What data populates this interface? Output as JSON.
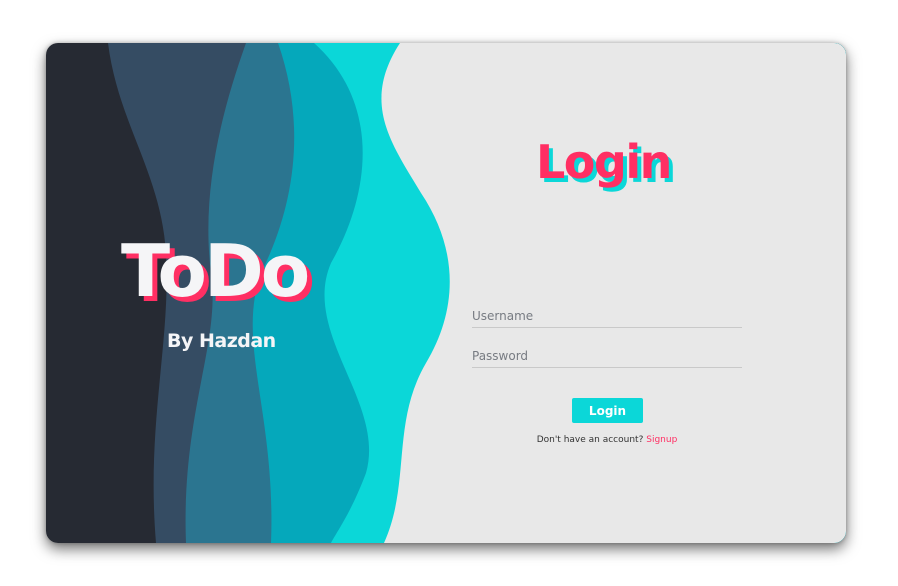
{
  "brand": {
    "title": "ToDo",
    "subtitle": "By Hazdan"
  },
  "login": {
    "title": "Login",
    "username_placeholder": "Username",
    "password_placeholder": "Password",
    "button_label": "Login",
    "signup_prompt": "Don't have an account?",
    "signup_link": "Signup"
  },
  "colors": {
    "accent_pink": "#ff2f63",
    "accent_cyan": "#0bd7d8",
    "panel_bg": "#e8e8e8",
    "wave_dark": "#262a33",
    "wave_slate": "#354c63",
    "wave_steel": "#2b7590",
    "wave_teal": "#05a8bb",
    "wave_cyan": "#0bd7d8"
  }
}
